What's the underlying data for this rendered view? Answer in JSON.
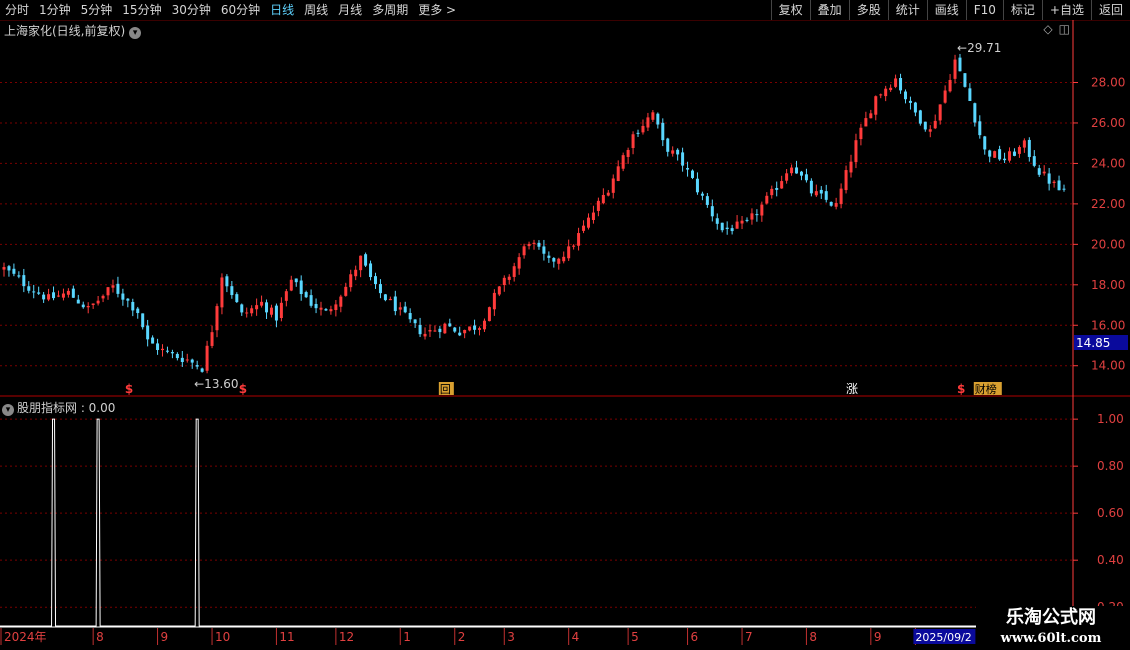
{
  "toolbar": {
    "periods": [
      "分时",
      "1分钟",
      "5分钟",
      "15分钟",
      "30分钟",
      "60分钟",
      "日线",
      "周线",
      "月线",
      "多周期",
      "更多 >"
    ],
    "active_period": "日线",
    "actions": [
      "复权",
      "叠加",
      "多股",
      "统计",
      "画线",
      "F10",
      "标记",
      "+自选",
      "返回"
    ]
  },
  "chart_title": "上海家化(日线,前复权)",
  "indicator_title": "股朋指标网 : 0.00",
  "colors": {
    "up": "#ff3b3b",
    "down": "#5ad7ff",
    "grid": "#7a0000",
    "axis": "#ff3b3b",
    "highlight_bg": "#0a0a9c"
  },
  "chart_data": [
    {
      "type": "candlestick",
      "title": "上海家化(日线,前复权)",
      "ylim": [
        12.8,
        30.2
      ],
      "yticks": [
        14,
        16,
        18,
        20,
        22,
        24,
        26,
        28
      ],
      "ytick_labels": [
        "14.00",
        "16.00",
        "18.00",
        "20.00",
        "22.00",
        "24.00",
        "26.00",
        "28.00"
      ],
      "current_price": "14.85",
      "annotations": {
        "low": "13.60",
        "high": "29.71"
      },
      "x_month_labels": [
        {
          "label": "2024年",
          "index": 0
        },
        {
          "label": "8",
          "index": 18
        },
        {
          "label": "9",
          "index": 31
        },
        {
          "label": "10",
          "index": 42
        },
        {
          "label": "11",
          "index": 55
        },
        {
          "label": "12",
          "index": 67
        },
        {
          "label": "1",
          "index": 80
        },
        {
          "label": "2",
          "index": 91
        },
        {
          "label": "3",
          "index": 101
        },
        {
          "label": "4",
          "index": 114
        },
        {
          "label": "5",
          "index": 126
        },
        {
          "label": "6",
          "index": 138
        },
        {
          "label": "7",
          "index": 149
        },
        {
          "label": "8",
          "index": 162
        },
        {
          "label": "9",
          "index": 175
        },
        {
          "label": "2025/09/2",
          "index": 184
        }
      ],
      "markers": [
        {
          "label": "$",
          "index": 25,
          "style": "dollar"
        },
        {
          "label": "$",
          "index": 48,
          "style": "dollar"
        },
        {
          "label": "回",
          "index": 89,
          "style": "box"
        },
        {
          "label": "涨",
          "index": 171,
          "style": "plain"
        },
        {
          "label": "$",
          "index": 193,
          "style": "dollar"
        },
        {
          "label": "财榜",
          "index": 197,
          "style": "box"
        }
      ],
      "close_points": [
        [
          0,
          18.8
        ],
        [
          5,
          17.9
        ],
        [
          9,
          17.3
        ],
        [
          13,
          17.6
        ],
        [
          17,
          16.8
        ],
        [
          22,
          17.9
        ],
        [
          27,
          16.7
        ],
        [
          29,
          15.2
        ],
        [
          33,
          14.6
        ],
        [
          37,
          14.3
        ],
        [
          40,
          13.9
        ],
        [
          42,
          15.8
        ],
        [
          44,
          18.5
        ],
        [
          46,
          17.6
        ],
        [
          48,
          16.5
        ],
        [
          52,
          17.1
        ],
        [
          55,
          16.4
        ],
        [
          58,
          18.2
        ],
        [
          62,
          17.1
        ],
        [
          65,
          16.6
        ],
        [
          69,
          17.9
        ],
        [
          72,
          19.3
        ],
        [
          75,
          17.8
        ],
        [
          79,
          16.9
        ],
        [
          83,
          15.9
        ],
        [
          85,
          15.6
        ],
        [
          89,
          16.0
        ],
        [
          92,
          15.7
        ],
        [
          96,
          16.0
        ],
        [
          99,
          17.4
        ],
        [
          102,
          18.5
        ],
        [
          106,
          20.2
        ],
        [
          110,
          19.1
        ],
        [
          114,
          19.7
        ],
        [
          118,
          21.2
        ],
        [
          122,
          22.8
        ],
        [
          127,
          25.4
        ],
        [
          131,
          26.5
        ],
        [
          133,
          25.0
        ],
        [
          137,
          24.0
        ],
        [
          141,
          22.3
        ],
        [
          145,
          20.7
        ],
        [
          150,
          21.0
        ],
        [
          155,
          22.5
        ],
        [
          159,
          24.0
        ],
        [
          163,
          22.6
        ],
        [
          168,
          21.9
        ],
        [
          172,
          25.0
        ],
        [
          176,
          27.3
        ],
        [
          180,
          28.2
        ],
        [
          183,
          26.8
        ],
        [
          187,
          25.6
        ],
        [
          190,
          27.6
        ],
        [
          192,
          29.1
        ],
        [
          195,
          27.1
        ],
        [
          198,
          24.6
        ],
        [
          202,
          24.2
        ],
        [
          206,
          24.9
        ],
        [
          209,
          23.6
        ],
        [
          213,
          22.7
        ]
      ]
    },
    {
      "type": "line",
      "title": "股朋指标网 : 0.00",
      "ylim": [
        0.12,
        1.09
      ],
      "yticks": [
        0.2,
        0.4,
        0.6,
        0.8,
        1.0
      ],
      "ytick_labels": [
        "0.20",
        "0.40",
        "0.60",
        "0.80",
        "1.00"
      ],
      "spikes": [
        10,
        19,
        39
      ]
    }
  ],
  "watermark": {
    "line1": "乐淘公式网",
    "line2": "www.60lt.com"
  }
}
